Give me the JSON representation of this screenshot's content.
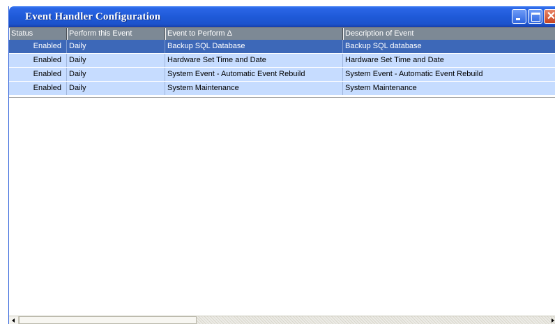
{
  "window": {
    "title": "Event Handler Configuration",
    "colors": {
      "titlebar": "#1f5ad8",
      "selected_row": "#3d68b8",
      "row": "#c6dcff",
      "header": "#7d8995"
    }
  },
  "titlebar_buttons": {
    "minimize_icon": "minimize-icon",
    "maximize_icon": "maximize-icon",
    "close_icon": "close-icon",
    "close_glyph": "✕"
  },
  "table": {
    "columns": [
      "Status",
      "Perform this Event",
      "Event to Perform Δ",
      "Description of Event"
    ],
    "rows": [
      {
        "status": "Enabled",
        "perform": "Daily",
        "event": "Backup SQL Database",
        "description": "Backup SQL database",
        "selected": true
      },
      {
        "status": "Enabled",
        "perform": "Daily",
        "event": "Hardware Set Time and Date",
        "description": "Hardware Set Time and Date",
        "selected": false
      },
      {
        "status": "Enabled",
        "perform": "Daily",
        "event": "System Event - Automatic Event Rebuild",
        "description": "System Event - Automatic Event Rebuild",
        "selected": false
      },
      {
        "status": "Enabled",
        "perform": "Daily",
        "event": "System Maintenance",
        "description": "System Maintenance",
        "selected": false
      }
    ]
  }
}
